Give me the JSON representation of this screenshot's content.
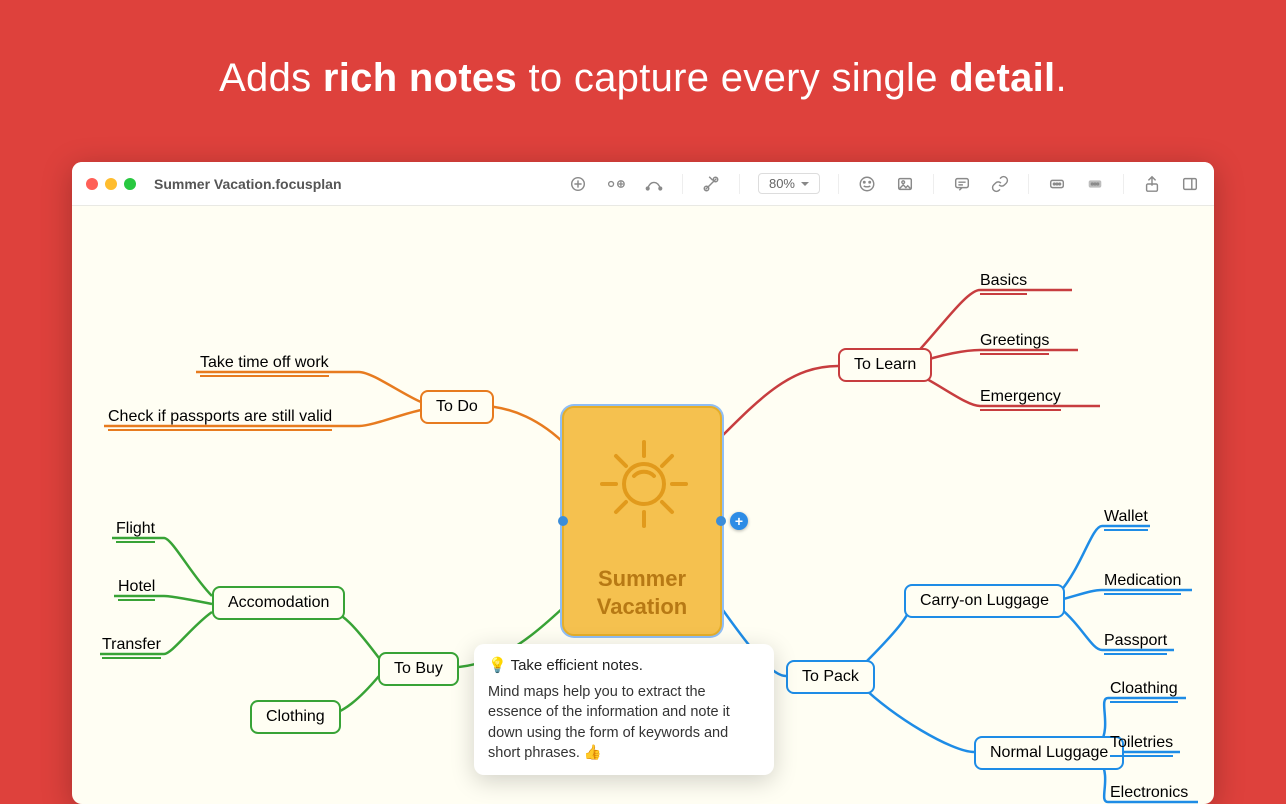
{
  "headline": {
    "pre": "Adds ",
    "b1": "rich notes",
    "mid": " to capture every single ",
    "b2": "detail",
    "post": "."
  },
  "window": {
    "title": "Summer Vacation.focusplan",
    "zoom": "80%"
  },
  "center": {
    "line1": "Summer",
    "line2": "Vacation"
  },
  "branches": {
    "todo": {
      "label": "To Do",
      "children": [
        "Take time off work",
        "Check if passports are still valid"
      ]
    },
    "tolearn": {
      "label": "To Learn",
      "children": [
        "Basics",
        "Greetings",
        "Emergency"
      ]
    },
    "tobuy": {
      "label": "To Buy",
      "accommodation": {
        "label": "Accomodation",
        "children": [
          "Flight",
          "Hotel",
          "Transfer"
        ]
      },
      "clothing": "Clothing"
    },
    "topack": {
      "label": "To Pack",
      "carry": {
        "label": "Carry-on Luggage",
        "children": [
          "Wallet",
          "Medication",
          "Passport"
        ]
      },
      "normal": {
        "label": "Normal Luggage",
        "children": [
          "Cloathing",
          "Toiletries",
          "Electronics"
        ]
      }
    }
  },
  "note": {
    "title": "💡 Take efficient notes.",
    "body": "Mind maps help you to extract the essence of the information and note it down using the form of keywords and short phrases. 👍"
  }
}
